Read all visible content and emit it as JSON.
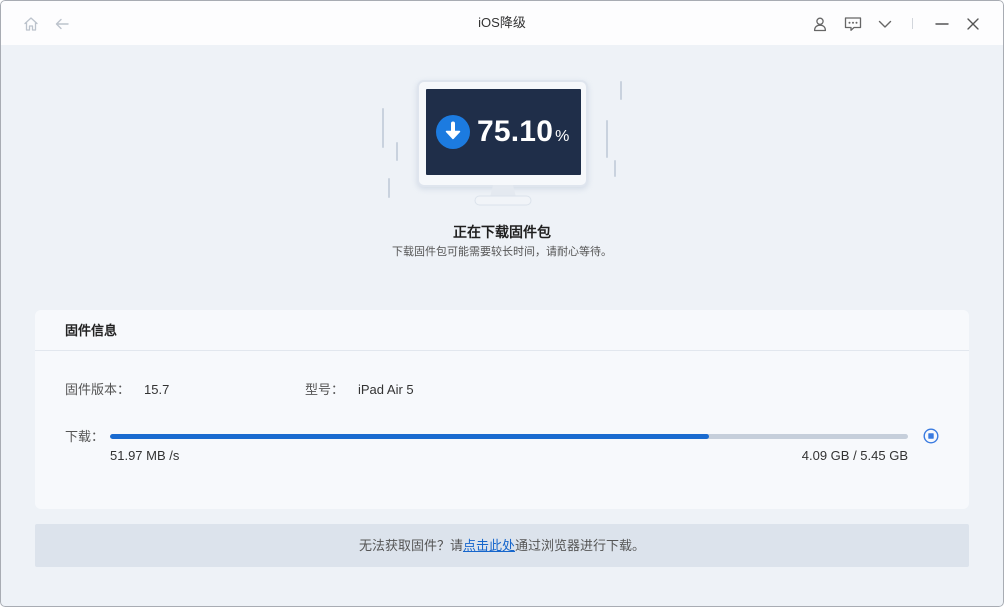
{
  "window": {
    "title": "iOS降级"
  },
  "titlebar": {
    "left_icons": [
      "home-icon",
      "back-arrow-icon"
    ],
    "right_icons": [
      "user-icon",
      "feedback-icon",
      "chevron-down-icon",
      "minimize-icon",
      "close-icon"
    ]
  },
  "monitor": {
    "icon": "download-arrow-icon",
    "percent_text": "75.10",
    "percent_unit": "%"
  },
  "status": {
    "title": "正在下载固件包",
    "subtitle": "下载固件包可能需要较长时间，请耐心等待。"
  },
  "firmware_card": {
    "header": "固件信息",
    "version_label": "固件版本：",
    "version_value": "15.7",
    "model_label": "型号：",
    "model_value": "iPad Air 5",
    "download_label": "下载：",
    "progress_percent": 75.1,
    "speed": "51.97 MB /s",
    "size": "4.09 GB / 5.45 GB",
    "stop_icon": "stop-download-icon"
  },
  "footer_banner": {
    "prefix": "无法获取固件？请",
    "link_text": "点击此处",
    "suffix": "通过浏览器进行下载。"
  },
  "colors": {
    "accent": "#1a6bd0",
    "screen": "#1f2e49",
    "background": "#eef2f7",
    "progress_track": "#c6cfdb",
    "banner": "#dce3ec"
  }
}
